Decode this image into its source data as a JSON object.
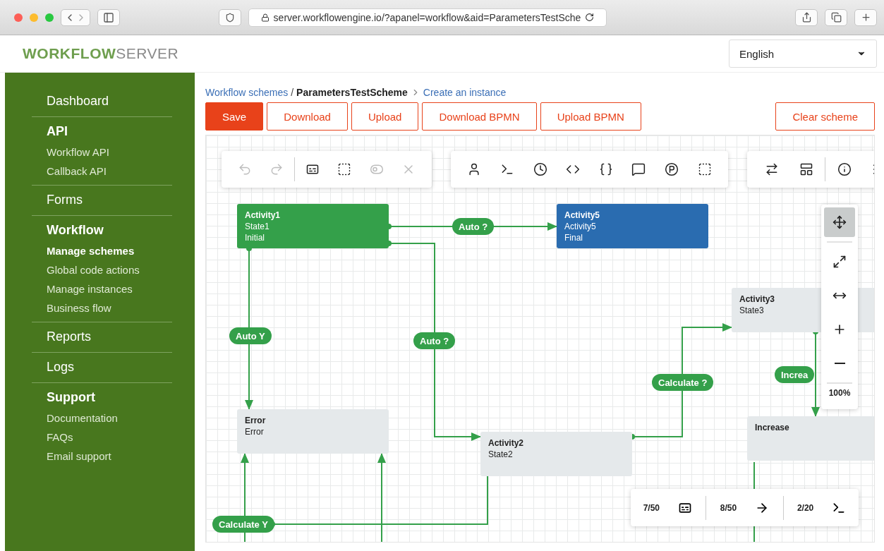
{
  "browser": {
    "url": "server.workflowengine.io/?apanel=workflow&aid=ParametersTestSche"
  },
  "header": {
    "logo_bold": "WORKFLOW",
    "logo_light": "SERVER",
    "language": "English"
  },
  "sidebar": {
    "sections": [
      {
        "title": "Dashboard"
      },
      {
        "title": "API",
        "items": [
          {
            "label": "Workflow API",
            "selected": false
          },
          {
            "label": "Callback API",
            "selected": false
          }
        ]
      },
      {
        "title": "Forms"
      },
      {
        "title": "Workflow",
        "items": [
          {
            "label": "Manage schemes",
            "selected": true
          },
          {
            "label": "Global code actions",
            "selected": false
          },
          {
            "label": "Manage instances",
            "selected": false
          },
          {
            "label": "Business flow",
            "selected": false
          }
        ]
      },
      {
        "title": "Reports"
      },
      {
        "title": "Logs"
      },
      {
        "title": "Support",
        "items": [
          {
            "label": "Documentation",
            "selected": false
          },
          {
            "label": "FAQs",
            "selected": false
          },
          {
            "label": "Email support",
            "selected": false
          }
        ]
      }
    ]
  },
  "breadcrumb": {
    "parent": "Workflow schemes",
    "separator": "/",
    "current": "ParametersTestScheme",
    "action": "Create an instance"
  },
  "actions": [
    {
      "label": "Save",
      "kind": "primary"
    },
    {
      "label": "Download",
      "kind": "outline"
    },
    {
      "label": "Upload",
      "kind": "outline"
    },
    {
      "label": "Download BPMN",
      "kind": "outline"
    },
    {
      "label": "Upload BPMN",
      "kind": "outline"
    },
    {
      "label": "Clear scheme",
      "kind": "outline"
    }
  ],
  "toolbars": [
    [
      {
        "kind": "undo",
        "disabled": true
      },
      {
        "kind": "redo",
        "disabled": true
      },
      {
        "kind": "sep"
      },
      {
        "kind": "text",
        "disabled": false
      },
      {
        "kind": "dashed-text",
        "disabled": false
      },
      {
        "kind": "toggle",
        "disabled": true
      },
      {
        "kind": "close",
        "disabled": true
      }
    ],
    [
      {
        "kind": "user",
        "disabled": false
      },
      {
        "kind": "terminal",
        "disabled": false
      },
      {
        "kind": "clock",
        "disabled": false
      },
      {
        "kind": "code",
        "disabled": false
      },
      {
        "kind": "braces",
        "disabled": false
      },
      {
        "kind": "comment",
        "disabled": false
      },
      {
        "kind": "parameter",
        "disabled": false
      },
      {
        "kind": "area",
        "disabled": false
      }
    ],
    [
      {
        "kind": "swap",
        "disabled": false
      },
      {
        "kind": "layout",
        "disabled": false
      },
      {
        "kind": "sep"
      },
      {
        "kind": "info",
        "disabled": false
      },
      {
        "kind": "list",
        "disabled": false
      }
    ]
  ],
  "nodes": [
    {
      "kind": "initial",
      "title": "Activity1",
      "lines": [
        "State1",
        "Initial"
      ]
    },
    {
      "kind": "final",
      "title": "Activity5",
      "lines": [
        "Activity5",
        "Final"
      ]
    },
    {
      "kind": "normal",
      "title": "Activity3",
      "lines": [
        "State3"
      ]
    },
    {
      "kind": "normal",
      "title": "Error",
      "lines": [
        "Error"
      ]
    },
    {
      "kind": "normal",
      "title": "Activity2",
      "lines": [
        "State2"
      ]
    },
    {
      "kind": "normal",
      "title": "Increase"
    }
  ],
  "transitions": [
    {
      "label": "Auto ?"
    },
    {
      "label": "Auto Y"
    },
    {
      "label": "Auto ?"
    },
    {
      "label": "Calculate ?"
    },
    {
      "label": "Increa"
    },
    {
      "label": "Calculate Y"
    }
  ],
  "zoom_panel": {
    "tools": [
      {
        "kind": "move",
        "selected": true
      },
      {
        "kind": "expand",
        "selected": false
      },
      {
        "kind": "fit",
        "selected": false
      },
      {
        "kind": "plus",
        "selected": false
      },
      {
        "kind": "minus",
        "selected": false
      }
    ],
    "zoom": "100%"
  },
  "counters": [
    {
      "value": "7/50",
      "kind": "text"
    },
    {
      "value": "8/50",
      "kind": "arrow"
    },
    {
      "value": "2/20",
      "kind": "terminal"
    }
  ]
}
